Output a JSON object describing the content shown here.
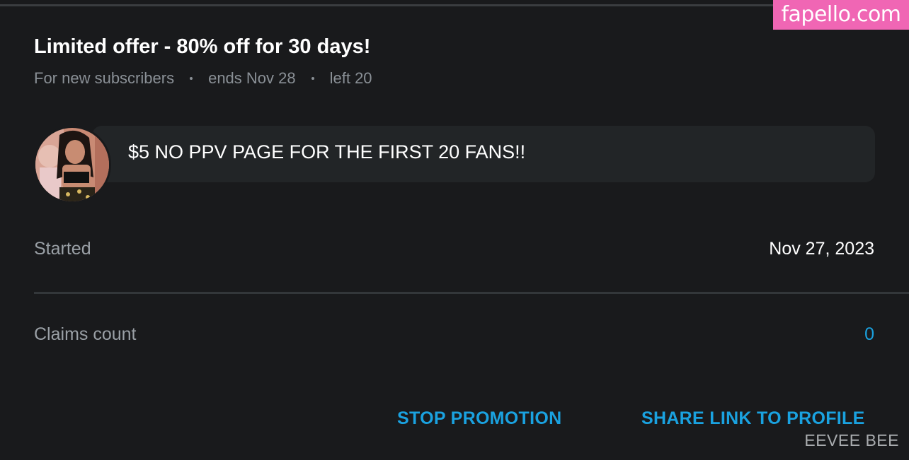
{
  "watermark": {
    "site": "fapello.com",
    "credit": "EEVEE BEE"
  },
  "offer": {
    "title": "Limited offer - 80% off for 30 days!",
    "audience": "For new subscribers",
    "ends": "ends Nov 28",
    "left": "left 20"
  },
  "message": {
    "text": "$5 NO PPV PAGE FOR THE FIRST 20 FANS!!"
  },
  "details": {
    "started_label": "Started",
    "started_value": "Nov 27, 2023",
    "claims_label": "Claims count",
    "claims_value": "0"
  },
  "actions": {
    "stop_label": "STOP PROMOTION",
    "share_label": "SHARE LINK TO PROFILE"
  },
  "colors": {
    "background": "#191a1c",
    "accent": "#1aa2e0",
    "bubble": "#222527",
    "muted_text": "#8a9096",
    "watermark_badge": "#f066b4"
  },
  "icons": {
    "avatar": "profile-avatar"
  }
}
